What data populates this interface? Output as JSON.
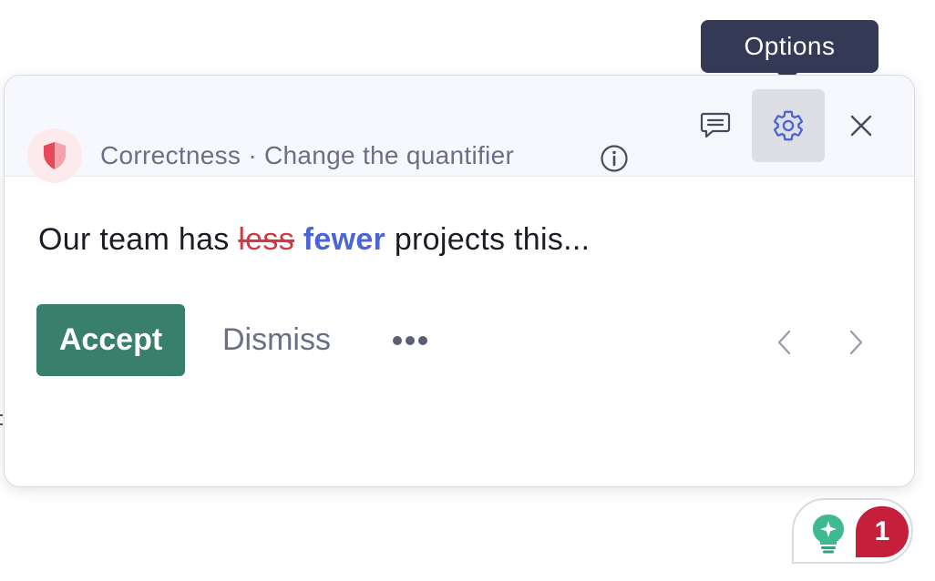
{
  "tooltip": {
    "text": "Options"
  },
  "header": {
    "buttons": [
      {
        "name": "feedback",
        "icon": "speech-bubble-icon"
      },
      {
        "name": "options",
        "icon": "gear-icon"
      },
      {
        "name": "close",
        "icon": "close-icon"
      }
    ]
  },
  "suggestion": {
    "category": "Correctness · Change the quantifier",
    "category_icon": "shield-icon",
    "info_icon": "info-icon",
    "sentence": {
      "before": "Our team has ",
      "removed": "less",
      "added": "fewer",
      "after": " projects this..."
    }
  },
  "actions": {
    "accept_label": "Accept",
    "dismiss_label": "Dismiss",
    "more_icon": "ellipsis-icon",
    "prev_icon": "chevron-left-icon",
    "next_icon": "chevron-right-icon"
  },
  "assistant": {
    "icon": "lightbulb-icon",
    "count": "1"
  },
  "colors": {
    "accent_green": "#38806c",
    "removed_red": "#d23744",
    "added_blue": "#4b65d4",
    "badge_red": "#c51f3b",
    "tooltip_bg": "#343a56"
  }
}
